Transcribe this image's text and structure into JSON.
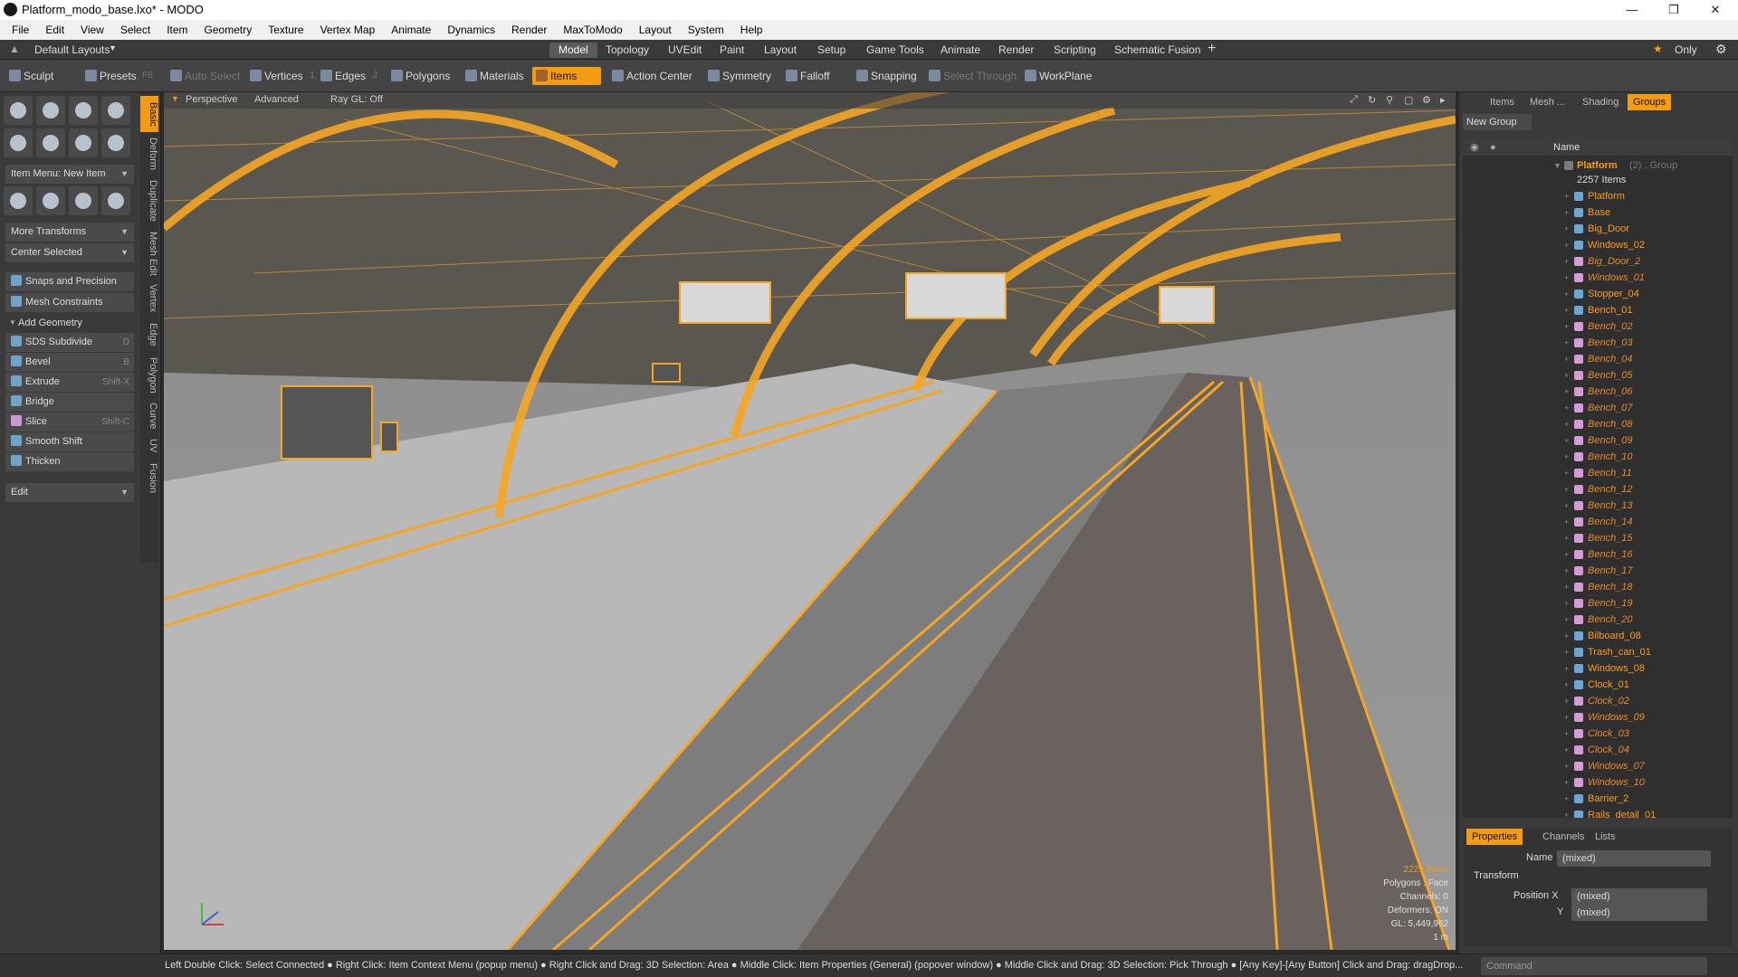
{
  "window": {
    "title": "Platform_modo_base.lxo* - MODO"
  },
  "menu": [
    "File",
    "Edit",
    "View",
    "Select",
    "Item",
    "Geometry",
    "Texture",
    "Vertex Map",
    "Animate",
    "Dynamics",
    "Render",
    "MaxToModo",
    "Layout",
    "System",
    "Help"
  ],
  "layout": {
    "selector": "Default Layouts",
    "tabs": [
      "Model",
      "Topology",
      "UVEdit",
      "Paint",
      "Layout",
      "Setup",
      "Game Tools",
      "Animate",
      "Render",
      "Scripting",
      "Schematic Fusion"
    ],
    "active_tab": "Model",
    "only": "Only"
  },
  "toolbar": {
    "sculpt": "Sculpt",
    "presets": "Presets",
    "presets_key": "F6",
    "auto_select": "Auto Select",
    "vertices": "Vertices",
    "vertices_key": "1",
    "edges": "Edges",
    "edges_key": "2",
    "polygons": "Polygons",
    "materials": "Materials",
    "items": "Items",
    "action_center": "Action Center",
    "symmetry": "Symmetry",
    "falloff": "Falloff",
    "snapping": "Snapping",
    "select_through": "Select Through",
    "workplane": "WorkPlane"
  },
  "left": {
    "item_menu": "Item Menu: New Item",
    "more_transforms": "More Transforms",
    "center_selected": "Center Selected",
    "snaps": "Snaps and Precision",
    "mesh_constraints": "Mesh Constraints",
    "add_geometry": "Add Geometry",
    "tools": [
      {
        "label": "SDS Subdivide",
        "key": "D"
      },
      {
        "label": "Bevel",
        "key": "B"
      },
      {
        "label": "Extrude",
        "key": "Shift-X"
      },
      {
        "label": "Bridge",
        "key": ""
      },
      {
        "label": "Slice",
        "key": "Shift-C"
      },
      {
        "label": "Smooth Shift",
        "key": ""
      },
      {
        "label": "Thicken",
        "key": ""
      }
    ],
    "edit": "Edit",
    "side_tabs": [
      "Basic",
      "Deform",
      "Duplicate",
      "Mesh Edit",
      "Vertex",
      "Edge",
      "Polygon",
      "Curve",
      "UV",
      "Fusion"
    ]
  },
  "viewport": {
    "mode": "Perspective",
    "advanced": "Advanced",
    "raygl": "Ray GL: Off",
    "stats": {
      "items": "2229 Items",
      "polygons": "Polygons : Face",
      "channels": "Channels: 0",
      "deformers": "Deformers: ON",
      "gl": "GL: 5,449,962",
      "scale": "1 m"
    }
  },
  "right": {
    "tabs": [
      "Items",
      "Mesh ...",
      "Shading",
      "Groups"
    ],
    "active_tab": "Groups",
    "new_group": "New Group",
    "col_name": "Name",
    "group_name": "Platform",
    "group_suffix": "(2) : Group",
    "group_count": "2257 Items",
    "items": [
      {
        "n": "Platform",
        "i": false
      },
      {
        "n": "Base",
        "i": false
      },
      {
        "n": "Big_Door",
        "i": false
      },
      {
        "n": "Windows_02",
        "i": false
      },
      {
        "n": "Big_Door_2",
        "i": true
      },
      {
        "n": "Windows_01",
        "i": true
      },
      {
        "n": "Stopper_04",
        "i": false
      },
      {
        "n": "Bench_01",
        "i": false
      },
      {
        "n": "Bench_02",
        "i": true
      },
      {
        "n": "Bench_03",
        "i": true
      },
      {
        "n": "Bench_04",
        "i": true
      },
      {
        "n": "Bench_05",
        "i": true
      },
      {
        "n": "Bench_06",
        "i": true
      },
      {
        "n": "Bench_07",
        "i": true
      },
      {
        "n": "Bench_08",
        "i": true
      },
      {
        "n": "Bench_09",
        "i": true
      },
      {
        "n": "Bench_10",
        "i": true
      },
      {
        "n": "Bench_11",
        "i": true
      },
      {
        "n": "Bench_12",
        "i": true
      },
      {
        "n": "Bench_13",
        "i": true
      },
      {
        "n": "Bench_14",
        "i": true
      },
      {
        "n": "Bench_15",
        "i": true
      },
      {
        "n": "Bench_16",
        "i": true
      },
      {
        "n": "Bench_17",
        "i": true
      },
      {
        "n": "Bench_18",
        "i": true
      },
      {
        "n": "Bench_19",
        "i": true
      },
      {
        "n": "Bench_20",
        "i": true
      },
      {
        "n": "Bilboard_08",
        "i": false
      },
      {
        "n": "Trash_can_01",
        "i": false
      },
      {
        "n": "Windows_08",
        "i": false
      },
      {
        "n": "Clock_01",
        "i": false
      },
      {
        "n": "Clock_02",
        "i": true
      },
      {
        "n": "Windows_09",
        "i": true
      },
      {
        "n": "Clock_03",
        "i": true
      },
      {
        "n": "Clock_04",
        "i": true
      },
      {
        "n": "Windows_07",
        "i": true
      },
      {
        "n": "Windows_10",
        "i": true
      },
      {
        "n": "Barrier_2",
        "i": false
      },
      {
        "n": "Rails_detail_01",
        "i": false
      }
    ],
    "prop_tabs": [
      "Properties",
      "Channels",
      "Lists"
    ],
    "prop_name_label": "Name",
    "prop_name_value": "(mixed)",
    "transform": "Transform",
    "posx_label": "Position X",
    "posx_value": "(mixed)",
    "y_label": "Y",
    "y_value": "(mixed)"
  },
  "status": {
    "text": "Left Double Click: Select Connected ● Right Click: Item Context Menu (popup menu) ● Right Click and Drag: 3D Selection: Area ● Middle Click: Item Properties (General) (popover window) ● Middle Click and Drag: 3D Selection: Pick Through ● [Any Key]-[Any Button] Click and Drag: dragDrop...",
    "command": "Command"
  }
}
